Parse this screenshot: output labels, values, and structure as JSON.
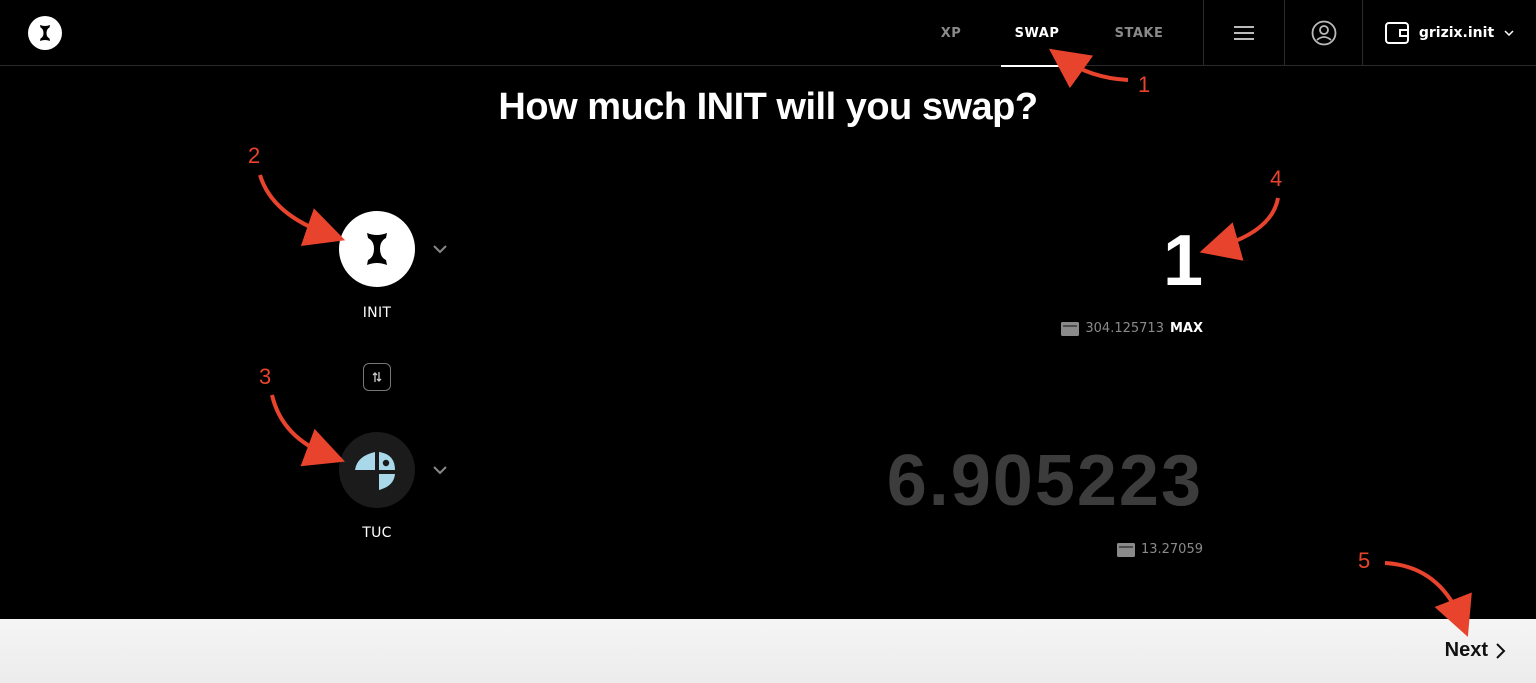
{
  "nav": {
    "tabs": [
      {
        "label": "XP",
        "active": false
      },
      {
        "label": "SWAP",
        "active": true
      },
      {
        "label": "STAKE",
        "active": false
      }
    ],
    "wallet_label": "grizix.init"
  },
  "heading": "How much INIT will you swap?",
  "from_token": {
    "symbol": "INIT",
    "amount": "1",
    "balance": "304.125713",
    "max_label": "MAX"
  },
  "to_token": {
    "symbol": "TUC",
    "amount": "6.905223",
    "balance": "13.27059"
  },
  "footer": {
    "next_label": "Next"
  },
  "annotations": [
    "1",
    "2",
    "3",
    "4",
    "5"
  ],
  "colors": {
    "background": "#000000",
    "accent_annotation": "#e8432c",
    "footer_bg": "#f2f2f2",
    "muted_amount": "#3c3c3c"
  }
}
